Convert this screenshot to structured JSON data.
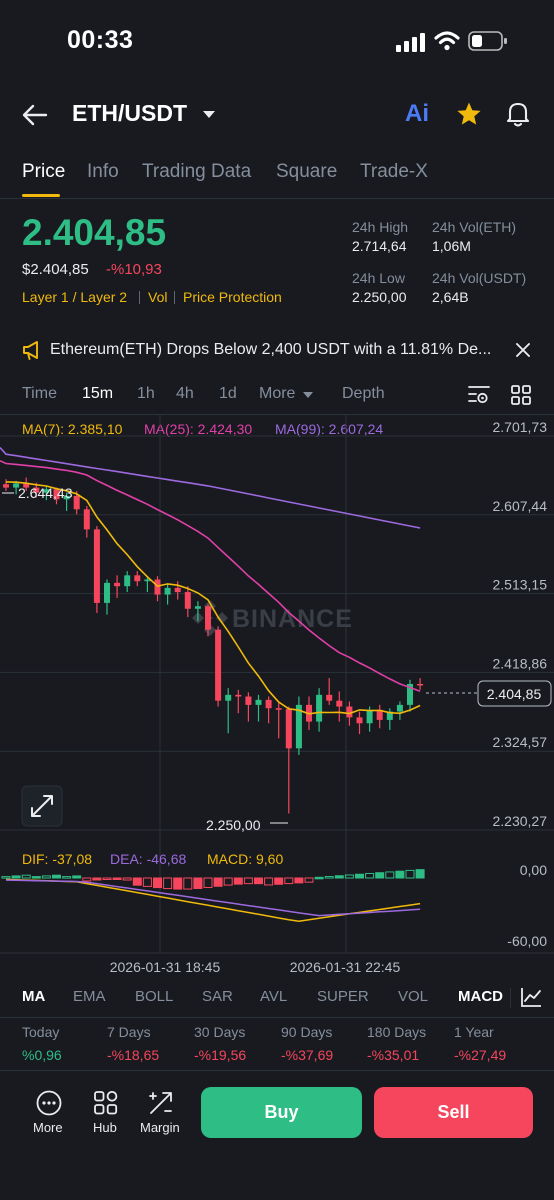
{
  "status_bar": {
    "time": "00:33"
  },
  "header": {
    "pair": "ETH/USDT",
    "ai_label": "Ai"
  },
  "tabs": [
    "Price",
    "Info",
    "Trading Data",
    "Square",
    "Trade-X"
  ],
  "ticker": {
    "price": "2.404,85",
    "fiat": "$2.404,85",
    "change": "-%10,93",
    "tags": [
      "Layer 1 / Layer 2",
      "Vol",
      "Price Protection"
    ],
    "high_label": "24h High",
    "high": "2.714,64",
    "low_label": "24h Low",
    "low": "2.250,00",
    "vol_eth_label": "24h Vol(ETH)",
    "vol_eth": "1,06M",
    "vol_usdt_label": "24h Vol(USDT)",
    "vol_usdt": "2,64B"
  },
  "banner": {
    "text": "Ethereum(ETH) Drops Below 2,400 USDT with a 11.81% De..."
  },
  "timeframes": {
    "time": "Time",
    "m15": "15m",
    "h1": "1h",
    "h4": "4h",
    "d1": "1d",
    "more": "More",
    "depth": "Depth"
  },
  "chart": {
    "ma7": "MA(7): 2.385,10",
    "ma25": "MA(25): 2.424,30",
    "ma99": "MA(99): 2.607,24",
    "price_axis": [
      "2.701,73",
      "2.607,44",
      "2.513,15",
      "2.418,86",
      "2.324,57",
      "2.230,27"
    ],
    "current_price": "2.404,85",
    "high_marker": "2.644,43",
    "low_marker": "2.250,00",
    "watermark": "BINANCE",
    "dif": "DIF: -37,08",
    "dea": "DEA: -46,68",
    "macd": "MACD: 9,60",
    "macd_axis": [
      "0,00",
      "-60,00"
    ],
    "time_labels": [
      "2026-01-31 18:45",
      "2026-01-31 22:45"
    ],
    "colors": {
      "up": "#2ebd85",
      "down": "#f6465d",
      "ma7": "#f0b90b",
      "ma25": "#e040a8",
      "ma99": "#9c6ade"
    }
  },
  "chart_data": {
    "type": "candlestick",
    "ohlc_approx": [
      [
        2644,
        2650,
        2636,
        2640
      ],
      [
        2640,
        2648,
        2632,
        2645
      ],
      [
        2645,
        2652,
        2636,
        2640
      ],
      [
        2640,
        2646,
        2628,
        2634
      ],
      [
        2634,
        2642,
        2625,
        2638
      ],
      [
        2638,
        2640,
        2620,
        2626
      ],
      [
        2626,
        2634,
        2612,
        2630
      ],
      [
        2630,
        2636,
        2608,
        2614
      ],
      [
        2614,
        2618,
        2580,
        2590
      ],
      [
        2590,
        2594,
        2490,
        2502
      ],
      [
        2502,
        2530,
        2488,
        2526
      ],
      [
        2526,
        2535,
        2508,
        2522
      ],
      [
        2522,
        2540,
        2515,
        2535
      ],
      [
        2535,
        2540,
        2522,
        2528
      ],
      [
        2528,
        2534,
        2515,
        2530
      ],
      [
        2530,
        2534,
        2504,
        2512
      ],
      [
        2512,
        2524,
        2500,
        2520
      ],
      [
        2520,
        2528,
        2506,
        2515
      ],
      [
        2515,
        2522,
        2485,
        2495
      ],
      [
        2495,
        2504,
        2480,
        2498
      ],
      [
        2498,
        2500,
        2462,
        2470
      ],
      [
        2470,
        2474,
        2378,
        2385
      ],
      [
        2385,
        2400,
        2346,
        2392
      ],
      [
        2392,
        2398,
        2370,
        2390
      ],
      [
        2390,
        2395,
        2360,
        2380
      ],
      [
        2380,
        2392,
        2360,
        2386
      ],
      [
        2386,
        2390,
        2358,
        2376
      ],
      [
        2376,
        2384,
        2340,
        2375
      ],
      [
        2375,
        2378,
        2250,
        2328
      ],
      [
        2328,
        2390,
        2320,
        2380
      ],
      [
        2380,
        2390,
        2350,
        2360
      ],
      [
        2360,
        2400,
        2348,
        2392
      ],
      [
        2392,
        2412,
        2380,
        2385
      ],
      [
        2385,
        2396,
        2360,
        2378
      ],
      [
        2378,
        2384,
        2355,
        2365
      ],
      [
        2365,
        2372,
        2345,
        2358
      ],
      [
        2358,
        2378,
        2348,
        2374
      ],
      [
        2374,
        2380,
        2352,
        2362
      ],
      [
        2362,
        2376,
        2350,
        2372
      ],
      [
        2372,
        2384,
        2362,
        2380
      ],
      [
        2380,
        2410,
        2372,
        2405
      ],
      [
        2405,
        2412,
        2398,
        2404
      ]
    ]
  },
  "indicators": [
    "MA",
    "EMA",
    "BOLL",
    "SAR",
    "AVL",
    "SUPER",
    "VOL",
    "MACD"
  ],
  "periods": [
    {
      "label": "Today",
      "value": "%0,96",
      "color": "#2ebd85"
    },
    {
      "label": "7 Days",
      "value": "-%18,65",
      "color": "#f6465d"
    },
    {
      "label": "30 Days",
      "value": "-%19,56",
      "color": "#f6465d"
    },
    {
      "label": "90 Days",
      "value": "-%37,69",
      "color": "#f6465d"
    },
    {
      "label": "180 Days",
      "value": "-%35,01",
      "color": "#f6465d"
    },
    {
      "label": "1 Year",
      "value": "-%27,49",
      "color": "#f6465d"
    }
  ],
  "bottom_nav": {
    "more": "More",
    "hub": "Hub",
    "margin": "Margin",
    "buy": "Buy",
    "sell": "Sell"
  }
}
